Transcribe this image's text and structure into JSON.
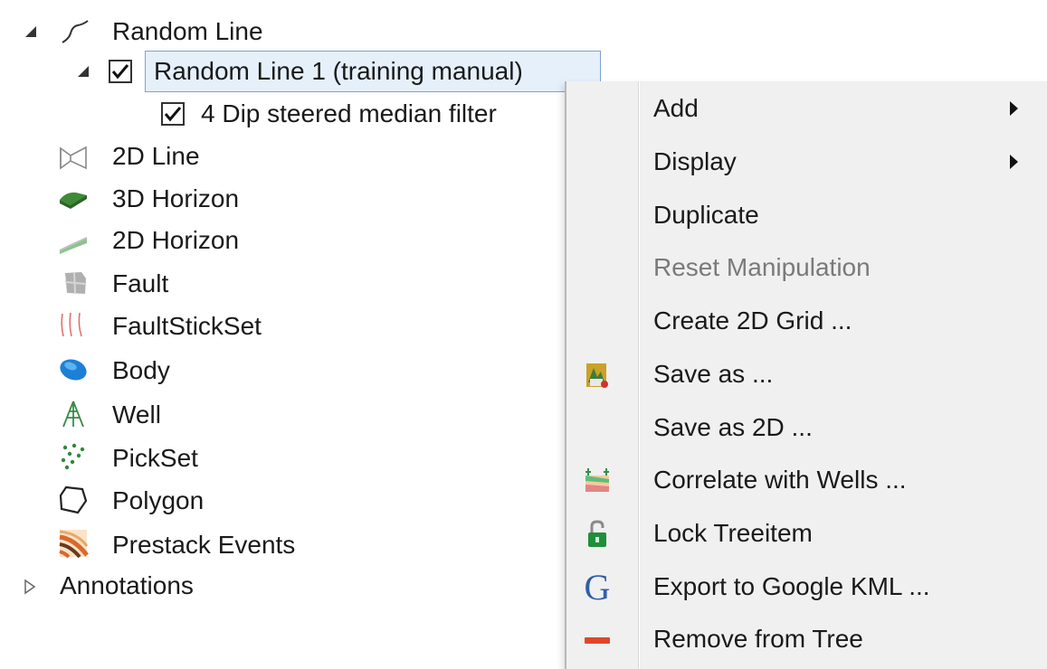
{
  "tree": {
    "random_line": "Random Line",
    "random_line_1": "Random Line 1 (training manual)",
    "dip_filter": "4 Dip steered median filter",
    "items": [
      {
        "label": "2D Line",
        "icon": "2d-line-icon"
      },
      {
        "label": "3D Horizon",
        "icon": "3d-horizon-icon"
      },
      {
        "label": "2D Horizon",
        "icon": "2d-horizon-icon"
      },
      {
        "label": "Fault",
        "icon": "fault-icon"
      },
      {
        "label": "FaultStickSet",
        "icon": "faultstickset-icon"
      },
      {
        "label": "Body",
        "icon": "body-icon"
      },
      {
        "label": "Well",
        "icon": "well-icon"
      },
      {
        "label": "PickSet",
        "icon": "pickset-icon"
      },
      {
        "label": "Polygon",
        "icon": "polygon-icon"
      },
      {
        "label": "Prestack Events",
        "icon": "prestack-events-icon"
      }
    ],
    "annotations": "Annotations"
  },
  "menu": {
    "items": [
      {
        "label": "Add",
        "submenu": true
      },
      {
        "label": "Display",
        "submenu": true
      },
      {
        "label": "Duplicate"
      },
      {
        "label": "Reset Manipulation",
        "disabled": true
      },
      {
        "label": "Create 2D Grid ..."
      },
      {
        "label": "Save as ...",
        "icon": "save-icon"
      },
      {
        "label": "Save as 2D ..."
      },
      {
        "label": "Correlate with Wells ...",
        "icon": "correlate-wells-icon"
      },
      {
        "label": "Lock Treeitem",
        "icon": "lock-icon"
      },
      {
        "label": "Export to Google KML ...",
        "icon": "google-icon"
      },
      {
        "label": "Remove from Tree",
        "icon": "remove-icon"
      }
    ]
  },
  "colors": {
    "selection_bg": "#e5f0fb",
    "selection_border": "#7da2ce",
    "menu_bg": "#f0f0f0",
    "disabled_text": "#7a7a7a"
  }
}
